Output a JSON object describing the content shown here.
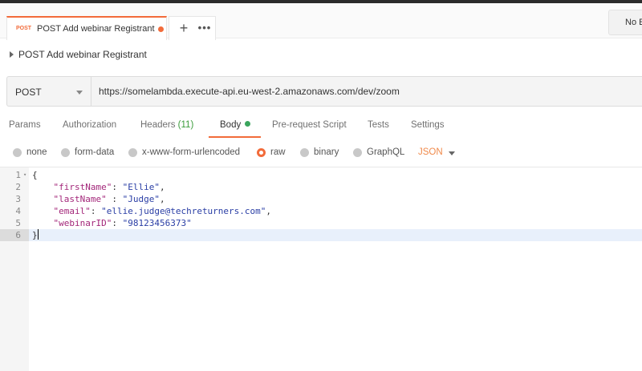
{
  "tab": {
    "method": "POST",
    "title": "POST Add webinar Registrant",
    "unsaved_color": "#f26b3a"
  },
  "tab_actions": {
    "plus": "+",
    "more": "•••"
  },
  "environment": {
    "label": "No E"
  },
  "breadcrumb": {
    "title": "POST Add webinar Registrant"
  },
  "request": {
    "method": "POST",
    "url": "https://somelambda.execute-api.eu-west-2.amazonaws.com/dev/zoom"
  },
  "request_tabs": {
    "params": "Params",
    "authorization": "Authorization",
    "headers": "Headers",
    "headers_count": "(11)",
    "body": "Body",
    "pre_request_script": "Pre-request Script",
    "tests": "Tests",
    "settings": "Settings",
    "active": "Body"
  },
  "body_types": {
    "none": "none",
    "form_data": "form-data",
    "urlencoded": "x-www-form-urlencoded",
    "raw": "raw",
    "binary": "binary",
    "graphql": "GraphQL",
    "selected": "raw",
    "format": "JSON"
  },
  "editor": {
    "line_numbers": [
      "1",
      "2",
      "3",
      "4",
      "5",
      "6"
    ],
    "open_brace": "{",
    "close_brace": "}",
    "fields": [
      {
        "key": "\"firstName\"",
        "sep": ": ",
        "value": "\"Ellie\"",
        "trail": ","
      },
      {
        "key": "\"lastName\"",
        "sep": " : ",
        "value": "\"Judge\"",
        "trail": ","
      },
      {
        "key": "\"email\"",
        "sep": ": ",
        "value": "\"ellie.judge@techreturners.com\"",
        "trail": ","
      },
      {
        "key": "\"webinarID\"",
        "sep": ": ",
        "value": "\"98123456373\"",
        "trail": ""
      }
    ],
    "active_line": "6"
  },
  "colors": {
    "accent": "#f26b3a",
    "body_indicator": "#3aa55d",
    "json_key": "#a3277a",
    "json_string": "#2a3ea5"
  }
}
